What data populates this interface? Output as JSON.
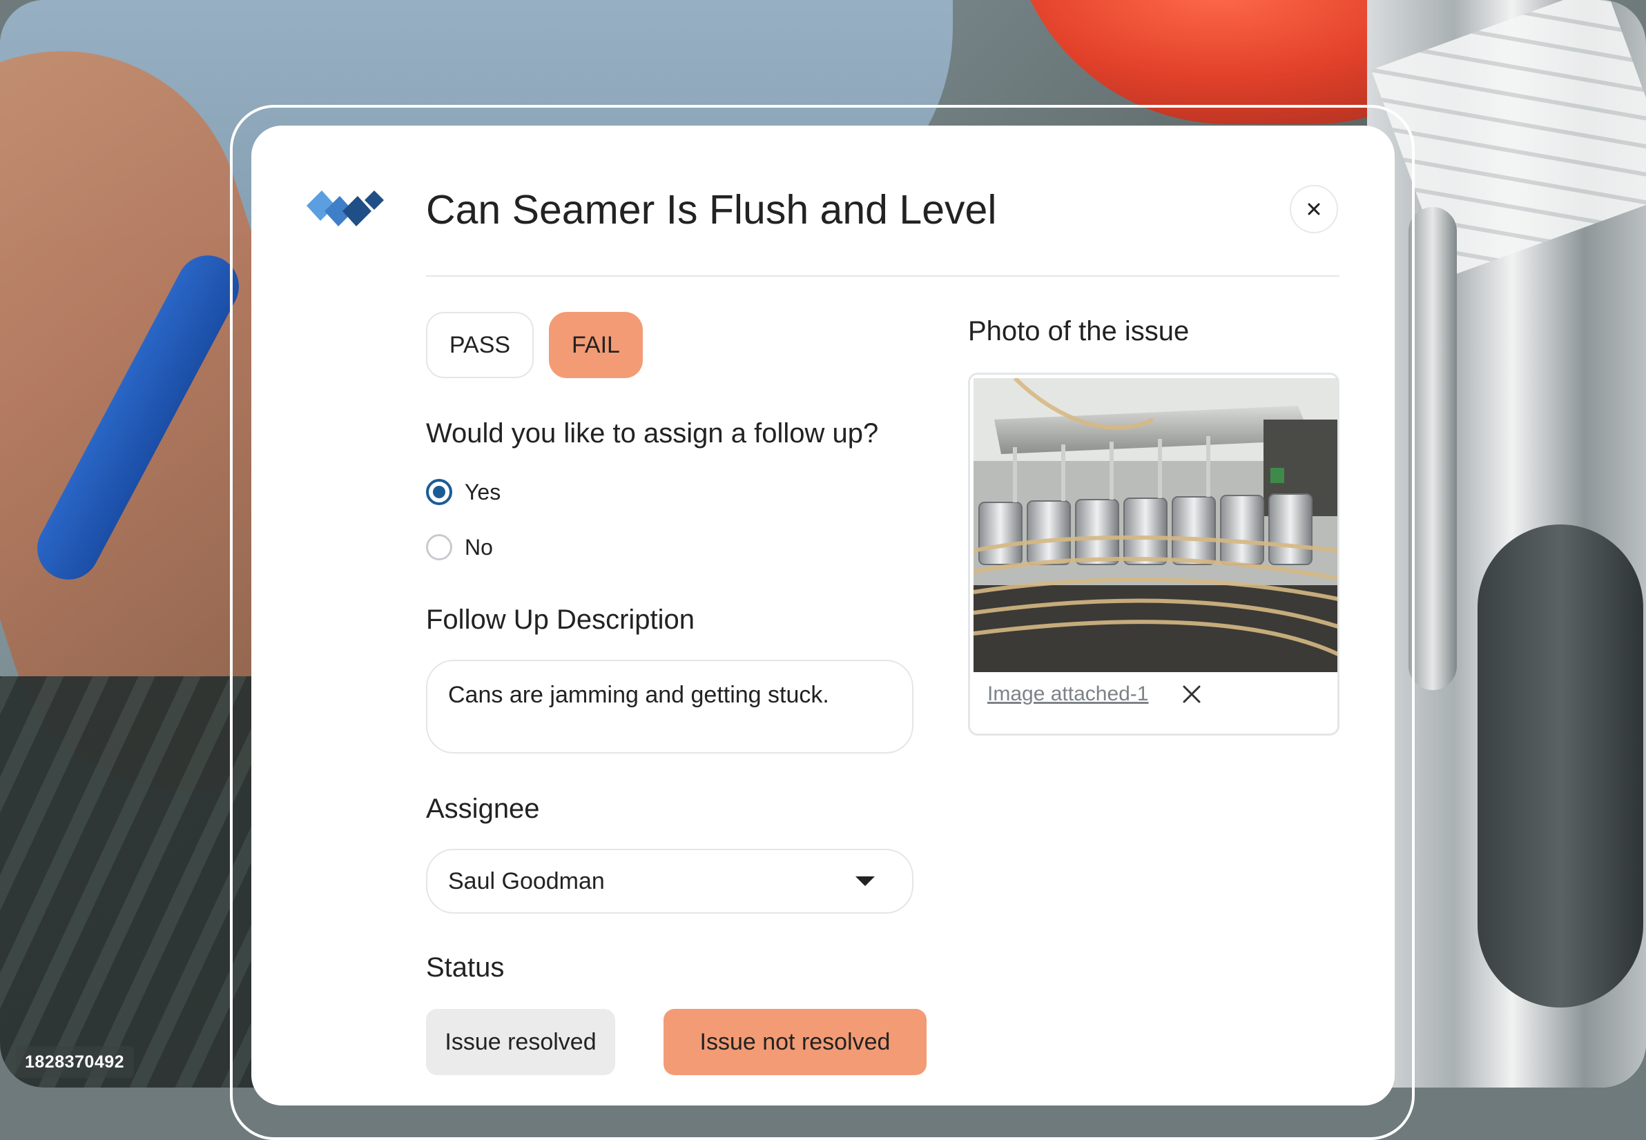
{
  "watermark": "1828370492",
  "modal": {
    "title": "Can Seamer Is Flush and Level",
    "pass_label": "PASS",
    "fail_label": "FAIL",
    "followup_question": "Would you like to assign a follow up?",
    "radio_yes": "Yes",
    "radio_no": "No",
    "selected_option": "Yes",
    "description_label": "Follow Up Description",
    "description_value": "Cans are jamming and getting stuck.",
    "assignee_label": "Assignee",
    "assignee_value": "Saul Goodman",
    "status_label": "Status",
    "status_resolved": "Issue resolved",
    "status_not_resolved": "Issue not resolved",
    "photo_label": "Photo of the issue",
    "attachment_name": "Image attached-1"
  },
  "colors": {
    "accent_orange": "#f39b75",
    "radio_blue": "#1b5c95",
    "logo_light": "#5b9fe0",
    "logo_dark": "#1f4f86"
  },
  "icons": [
    "close-icon",
    "chevron-down-icon",
    "remove-icon",
    "brand-logo"
  ]
}
